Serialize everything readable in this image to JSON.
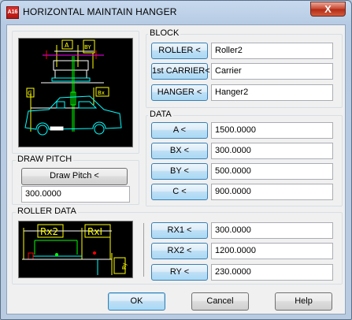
{
  "window": {
    "title": "HORIZONTAL MAINTAIN HANGER",
    "close_label": "X",
    "app_icon_text": "A16"
  },
  "block": {
    "label": "BLOCK",
    "rows": [
      {
        "button": "ROLLER <",
        "value": "Roller2"
      },
      {
        "button": "1st CARRIER<",
        "value": "Carrier"
      },
      {
        "button": "HANGER <",
        "value": "Hanger2"
      }
    ]
  },
  "data": {
    "label": "DATA",
    "rows": [
      {
        "button": "A <",
        "value": "1500.0000"
      },
      {
        "button": "BX <",
        "value": "300.0000"
      },
      {
        "button": "BY <",
        "value": "500.0000"
      },
      {
        "button": "C <",
        "value": "900.0000"
      }
    ]
  },
  "draw_pitch": {
    "label": "DRAW PITCH",
    "button": "Draw Pitch <",
    "value": "300.0000"
  },
  "roller_data": {
    "label": "ROLLER DATA",
    "rows": [
      {
        "button": "RX1 <",
        "value": "300.0000"
      },
      {
        "button": "RX2 <",
        "value": "1200.0000"
      },
      {
        "button": "RY <",
        "value": "230.0000"
      }
    ]
  },
  "preview_labels": {
    "hanger": {
      "a": "A",
      "by": "BY",
      "c": "C",
      "bx": "Bx"
    },
    "roller": {
      "rx2": "Rx2",
      "rx1": "RxI",
      "ry": "Ry"
    }
  },
  "footer": {
    "ok": "OK",
    "cancel": "Cancel",
    "help": "Help"
  },
  "colors": {
    "preview_bg": "#000000",
    "drawing_cyan": "#00ffff",
    "drawing_yellow": "#ffff00",
    "drawing_green": "#00ff00",
    "drawing_red": "#ff0000",
    "drawing_magenta": "#ff00ff"
  }
}
